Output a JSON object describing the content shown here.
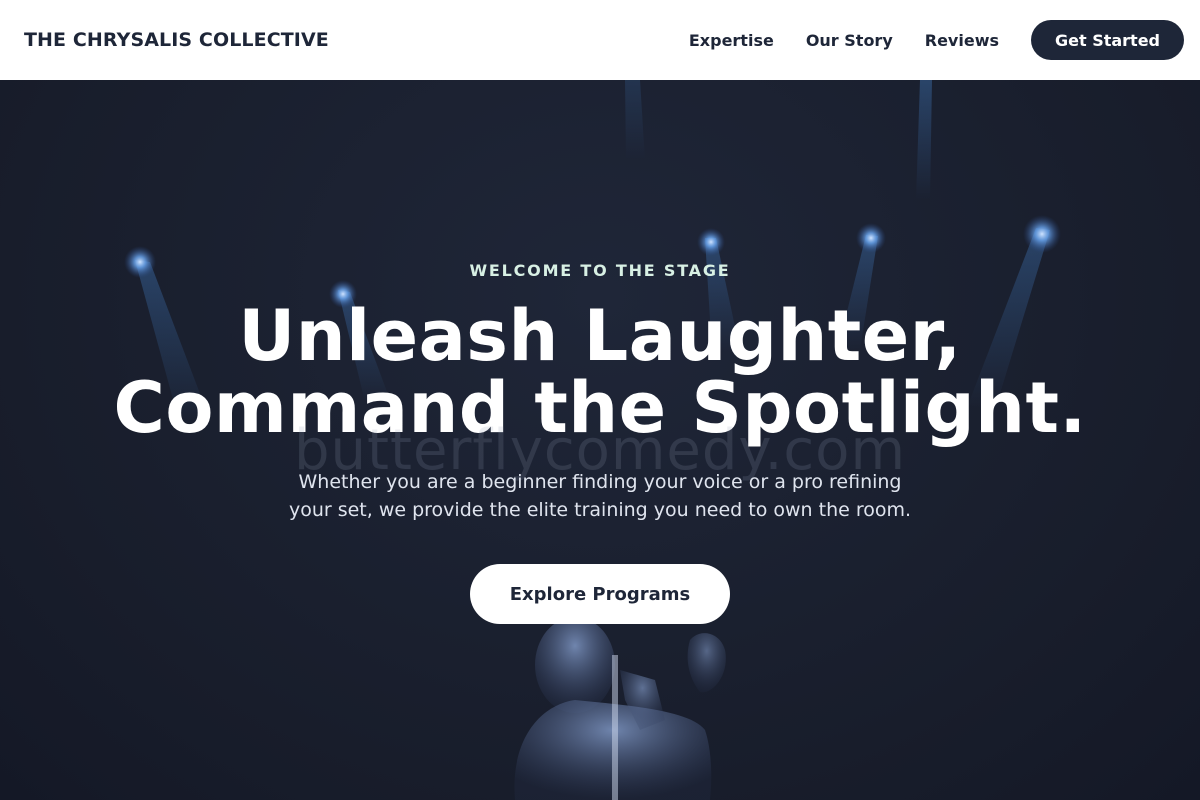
{
  "nav": {
    "brand": "THE CHRYSALIS COLLECTIVE",
    "links": [
      "Expertise",
      "Our Story",
      "Reviews"
    ],
    "cta_label": "Get Started"
  },
  "hero": {
    "eyebrow": "WELCOME TO THE STAGE",
    "headline_line1": "Unleash Laughter,",
    "headline_line2": "Command the Spotlight.",
    "watermark": "butterflycomedy.com",
    "subtitle_line1": "Whether you are a beginner finding your voice or a pro refining",
    "subtitle_line2": "your set, we provide the elite training you need to own the room.",
    "button_label": "Explore Programs",
    "background_image": "comedian-on-stage-with-spotlights"
  },
  "colors": {
    "navy": "#1e2638",
    "hero_bg": "#1b2030",
    "spotlight_blue": "#4a8fe0",
    "eyebrow_mint": "#d8f0e4"
  }
}
